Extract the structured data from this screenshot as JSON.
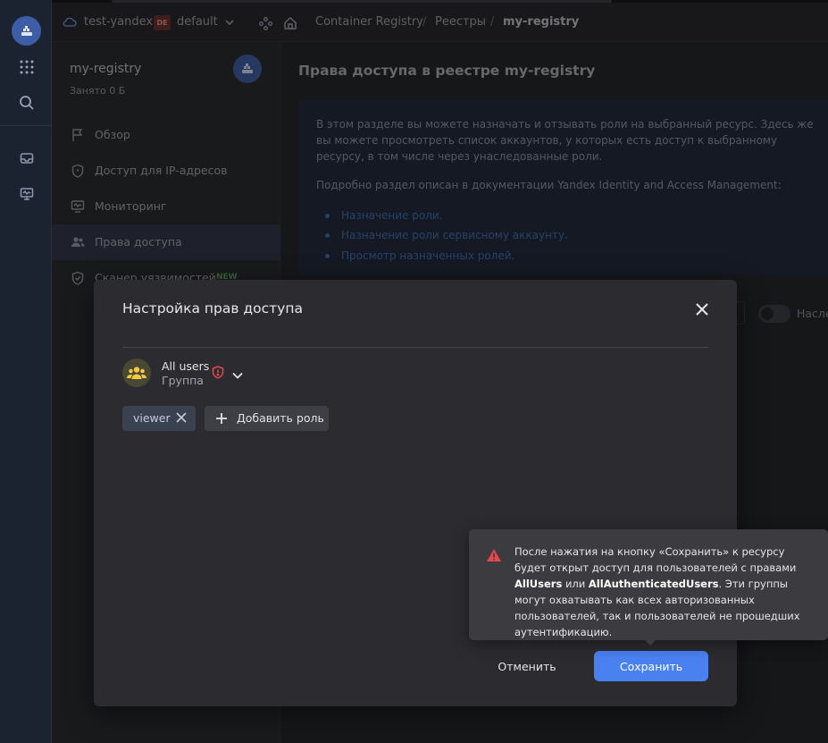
{
  "header": {
    "cloud_name": "test-yandex",
    "folder_badge": "DE",
    "folder_name": "default",
    "breadcrumb": [
      "Container Registry",
      "/",
      "Реестры",
      "/",
      "my-registry"
    ]
  },
  "sidebar": {
    "title": "my-registry",
    "subtitle": "Занято 0 Б",
    "items": [
      {
        "label": "Обзор",
        "icon": "flag-icon"
      },
      {
        "label": "Доступ для IP-адресов",
        "icon": "shield-icon"
      },
      {
        "label": "Мониторинг",
        "icon": "monitor-icon"
      },
      {
        "label": "Права доступа",
        "icon": "users-icon",
        "active": true
      },
      {
        "label": "Сканер уязвимостей",
        "icon": "shield-check-icon",
        "badge": "NEW"
      }
    ]
  },
  "main": {
    "title": "Права доступа в реестре my-registry",
    "info_p1": "В этом разделе вы можете назначать и отзывать роли на выбранный ресурс. Здесь же вы можете просмотреть список аккаунтов, у которых есть доступ к выбранному ресурсу, в том числе через унаследованные роли.",
    "info_p2": "Подробно раздел описан в документации Yandex Identity and Access Management:",
    "links": [
      "Назначение роли.",
      "Назначение роли сервисному аккаунту.",
      "Просмотр назначенных ролей."
    ],
    "toggle_label": "Насле"
  },
  "modal": {
    "title": "Настройка прав доступа",
    "subject_name": "All users",
    "subject_type": "Группа",
    "roles": [
      "viewer"
    ],
    "add_role_label": "Добавить роль",
    "cancel_label": "Отменить",
    "save_label": "Сохранить"
  },
  "tooltip": {
    "text_1": "После нажатия на кнопку «Сохранить» к ресурсу будет открыт доступ для пользователей с правами ",
    "bold_1": "AllUsers",
    "text_2": " или ",
    "bold_2": "AllAuthenticatedUsers",
    "text_3": ". Эти группы могут охватывать как всех авторизованных пользователей, так и пользователей не прошедших аутентификацию."
  },
  "colors": {
    "accent": "#4a81f1",
    "warning": "#e5484d",
    "link": "#3f6db3"
  }
}
